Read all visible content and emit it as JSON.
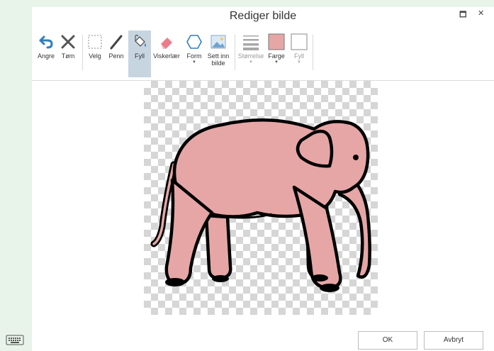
{
  "dialog": {
    "title": "Rediger bilde"
  },
  "window_controls": {
    "maximize": "🗖",
    "close": "✕"
  },
  "toolbar": {
    "undo": "Angre",
    "clear": "Tøm",
    "select": "Velg",
    "pen": "Penn",
    "fill": "Fyll",
    "eraser": "Viskerlær",
    "shape": "Form",
    "insert_image_line1": "Sett inn",
    "insert_image_line2": "bilde",
    "size": "Størrelse",
    "color": "Farge",
    "fill_option": "Fyll",
    "active_tool": "Fyll",
    "current_color": "#e6a6a6",
    "accent_color": "#2f7fbf"
  },
  "buttons": {
    "ok": "OK",
    "cancel": "Avbryt"
  },
  "canvas": {
    "image": "elephant",
    "fill_color": "#e6a6a6",
    "outline_color": "#000000"
  }
}
